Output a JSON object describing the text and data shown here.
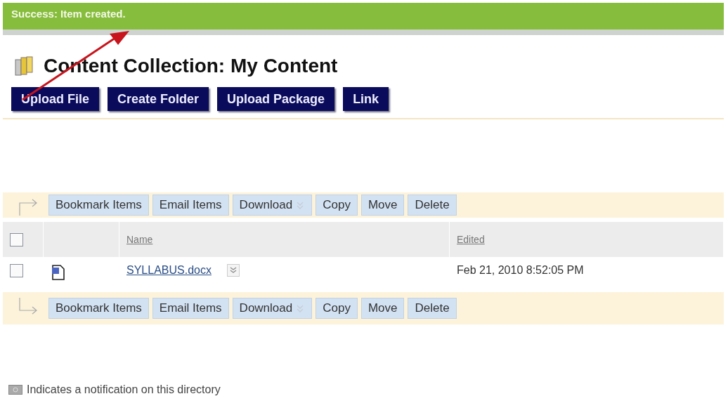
{
  "banner": {
    "message": "Success: Item created."
  },
  "page": {
    "title": "Content Collection: My Content"
  },
  "primary_buttons": [
    "Upload File",
    "Create Folder",
    "Upload Package",
    "Link"
  ],
  "action_bar": [
    {
      "label": "Bookmark Items",
      "menu": false
    },
    {
      "label": "Email Items",
      "menu": false
    },
    {
      "label": "Download",
      "menu": true
    },
    {
      "label": "Copy",
      "menu": false
    },
    {
      "label": "Move",
      "menu": false
    },
    {
      "label": "Delete",
      "menu": false
    }
  ],
  "table": {
    "columns": [
      "Name",
      "Edited"
    ],
    "select_all_checked": false,
    "rows": [
      {
        "name": "SYLLABUS.docx",
        "edited": "Feb 21, 2010 8:52:05 PM",
        "checked": false
      }
    ]
  },
  "bottom_action_bar": [
    {
      "label": "Bookmark Items",
      "menu": false
    },
    {
      "label": "Email Items",
      "menu": false
    },
    {
      "label": "Download",
      "menu": true
    },
    {
      "label": "Copy",
      "menu": false
    },
    {
      "label": "Move",
      "menu": false
    },
    {
      "label": "Delete",
      "menu": false
    }
  ],
  "legend": "Indicates a notification on this directory"
}
